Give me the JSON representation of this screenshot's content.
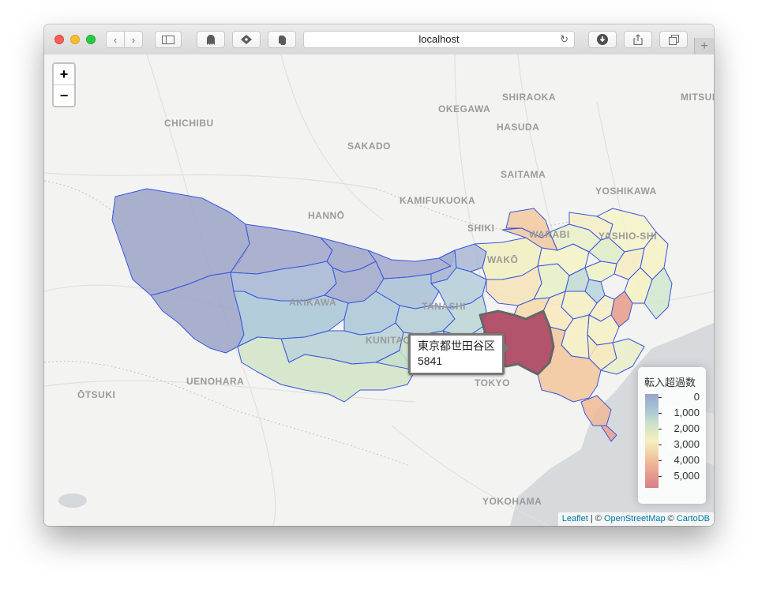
{
  "browser": {
    "address": "localhost",
    "reload_icon": "reload-icon",
    "back_icon": "chevron-left-icon",
    "forward_icon": "chevron-right-icon",
    "new_tab_label": "+"
  },
  "map": {
    "zoom_in_label": "+",
    "zoom_out_label": "−",
    "place_labels": [
      "CHICHIBU",
      "OKEGAWA",
      "SHIRAOKA",
      "MITSUK",
      "SAKADO",
      "HASUDA",
      "SAITAMA",
      "YOSHIKAWA",
      "KAMIFUKUOKA",
      "HANNŌ",
      "SHIKI",
      "WARABI",
      "YASHIO-SHI",
      "WAKŌ",
      "AKIKAWA",
      "TANASHI",
      "KUNITACHI",
      "TOKYO",
      "ŌTSUKI",
      "UENOHARA",
      "YOKOHAMA"
    ],
    "tooltip": {
      "name": "東京都世田谷区",
      "value": "5841"
    },
    "legend": {
      "title": "転入超過数",
      "ticks": [
        "0",
        "1,000",
        "2,000",
        "3,000",
        "4,000",
        "5,000"
      ],
      "colors": [
        "#9aa3c8",
        "#a7c5d6",
        "#cfe4c6",
        "#f5f0bd",
        "#f2c9a0",
        "#e9a08e",
        "#d87f8e"
      ]
    },
    "attribution": {
      "leaflet": "Leaflet",
      "sep1": " | © ",
      "osm": "OpenStreetMap",
      "sep2": " © ",
      "carto": "CartoDB"
    },
    "highlight_color": "#b04a64"
  }
}
